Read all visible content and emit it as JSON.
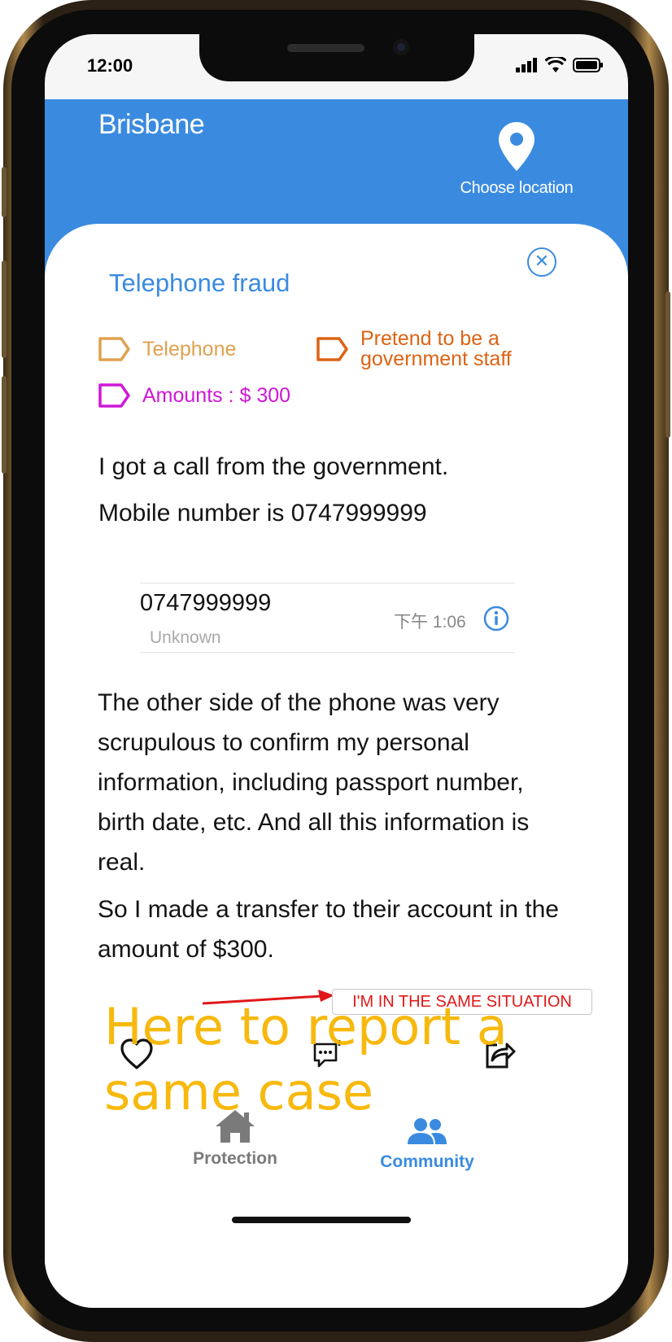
{
  "status_bar": {
    "time": "12:00"
  },
  "header": {
    "city": "Brisbane",
    "location_label": "Choose location",
    "color": "#3a8be0"
  },
  "post": {
    "title": "Telephone fraud",
    "tags": [
      {
        "label": "Telephone",
        "color": "#e0a150",
        "icon": "tag-icon"
      },
      {
        "label_line1": "Pretend to be a",
        "label_line2": "government staff",
        "color": "#dd6314",
        "icon": "tag-icon"
      },
      {
        "label": "Amounts : $ 300",
        "color": "#cf17d8",
        "icon": "tag-icon"
      }
    ],
    "intro_line1": "I got a call from the government.",
    "intro_line2": "Mobile number is 0747999999",
    "call_record": {
      "number": "0747999999",
      "label": "Unknown",
      "time": "下午 1:06",
      "icon": "info-icon"
    },
    "body_1": "The other side of the phone was very scrupulous to confirm my personal information, including passport number, birth date, etc. And all this information is real.",
    "body_2": "So I made a transfer to their account in the amount of $300."
  },
  "actions": {
    "like_icon": "heart-icon",
    "comment_icon": "comment-icon",
    "share_icon": "share-icon"
  },
  "annotation": {
    "button_label": "I'M IN THE SAME SITUATION",
    "overlay_line1": "Here to report a",
    "overlay_line2": "same case",
    "arrow_color": "#e01818",
    "overlay_color": "#f7b500"
  },
  "tab_bar": {
    "tabs": [
      {
        "label": "Protection",
        "icon": "home-icon",
        "active": false,
        "color": "#7a7a7a"
      },
      {
        "label": "Community",
        "icon": "people-icon",
        "active": true,
        "color": "#3a8be0"
      }
    ]
  }
}
